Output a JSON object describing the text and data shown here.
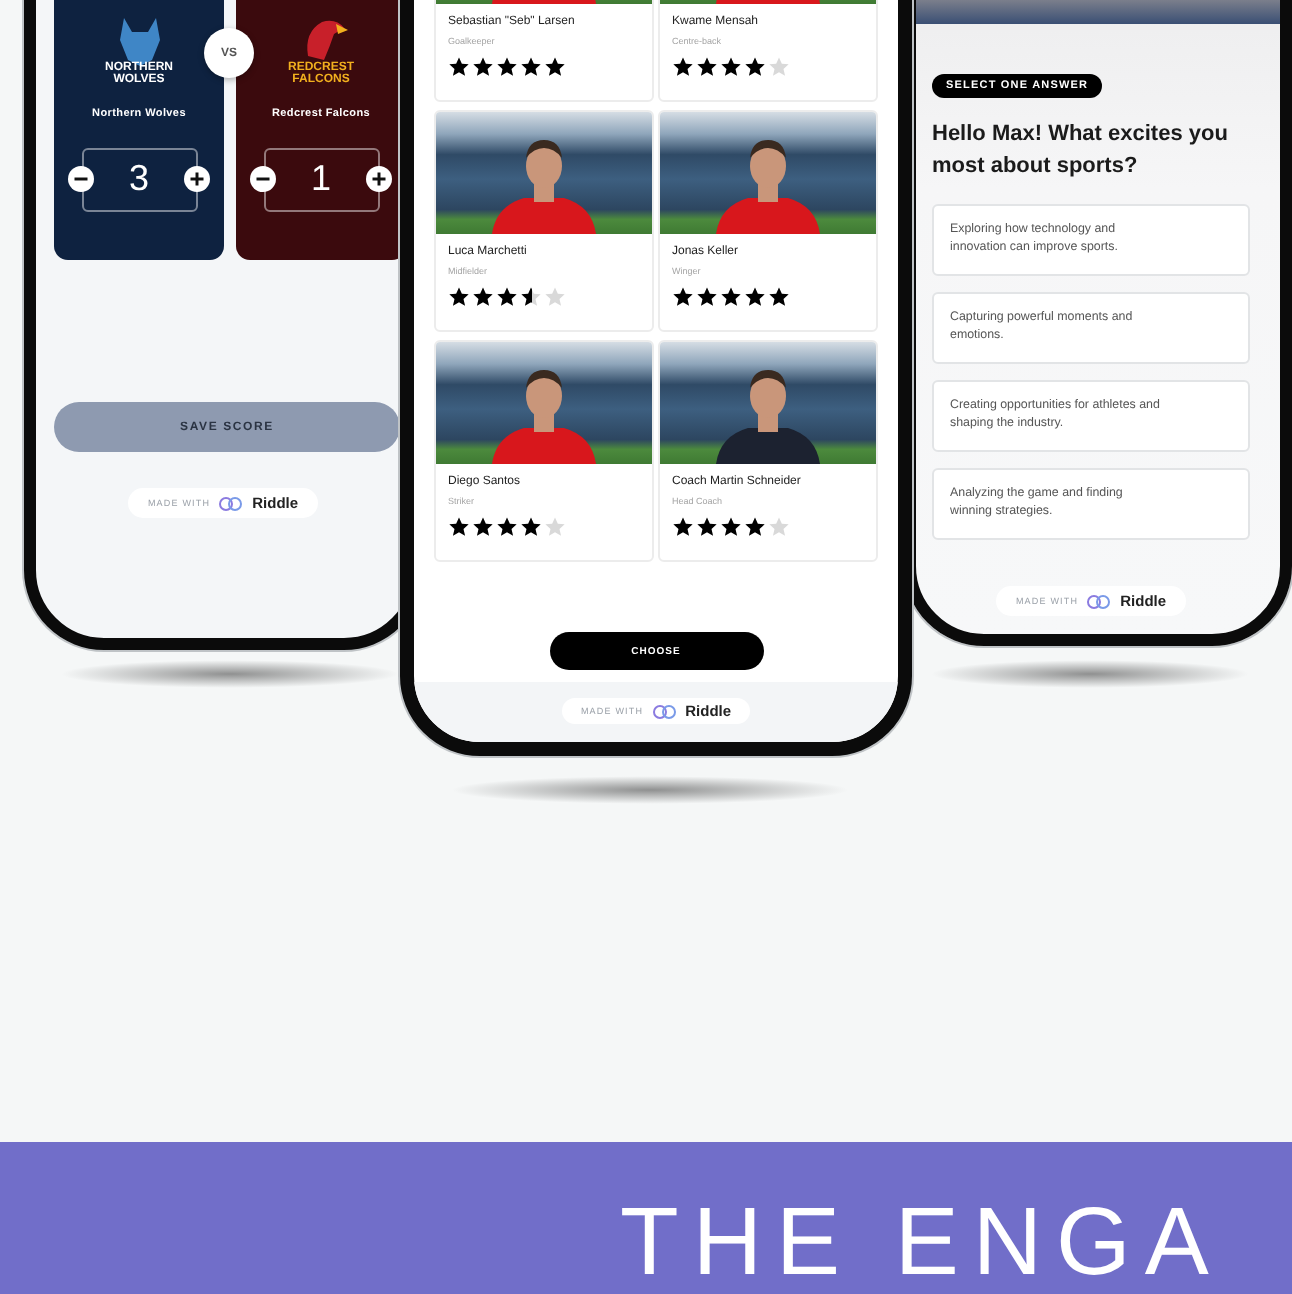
{
  "score_phone": {
    "teams": [
      {
        "name": "Northern Wolves",
        "logo_text": "NORTHERN WOLVES",
        "kind": "wolf",
        "color": "#0e2240",
        "score": "3"
      },
      {
        "name": "Redcrest Falcons",
        "logo_text": "REDCREST FALCONS",
        "kind": "falcon",
        "color": "#3b0a0d",
        "score": "1"
      }
    ],
    "versus": "VS",
    "save_button": {
      "label": "SAVE SCORE",
      "disabled": true
    },
    "made_with": {
      "label": "MADE WITH",
      "brand": "Riddle"
    }
  },
  "players_phone": {
    "players": [
      {
        "name": "Sebastian \"Seb\" Larsen",
        "role": "Goalkeeper",
        "stars": 5,
        "kind": "player"
      },
      {
        "name": "Kwame Mensah",
        "role": "Centre-back",
        "stars": 4,
        "kind": "player"
      },
      {
        "name": "Luca Marchetti",
        "role": "Midfielder",
        "stars": 3.5,
        "kind": "player"
      },
      {
        "name": "Jonas Keller",
        "role": "Winger",
        "stars": 5,
        "kind": "player"
      },
      {
        "name": "Diego Santos",
        "role": "Striker",
        "stars": 4,
        "kind": "player"
      },
      {
        "name": "Coach Martin Schneider",
        "role": "Head Coach",
        "stars": 4,
        "kind": "coach"
      }
    ],
    "choose_button": "CHOOSE",
    "made_with": {
      "label": "MADE WITH",
      "brand": "Riddle"
    }
  },
  "quiz_phone": {
    "tag": "SELECT ONE ANSWER",
    "question": "Hello Max! What excites you most about sports?",
    "answers": [
      {
        "text": "Exploring how technology and innovation can improve sports.",
        "selected": false
      },
      {
        "text": "Capturing powerful moments and emotions.",
        "selected": false
      },
      {
        "text": "Creating opportunities for athletes and shaping the industry.",
        "selected": false
      },
      {
        "text": "Analyzing the game and finding winning strategies.",
        "selected": false
      }
    ],
    "made_with": {
      "label": "MADE WITH",
      "brand": "Riddle"
    }
  },
  "banner": {
    "title": "THE ENGA"
  }
}
